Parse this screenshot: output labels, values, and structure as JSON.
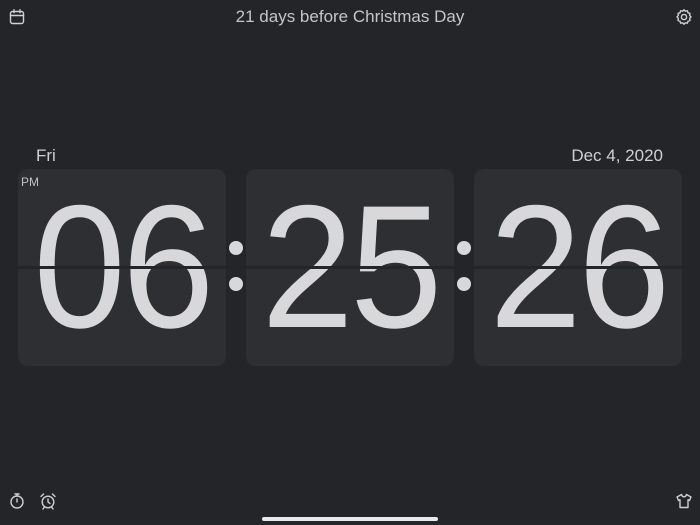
{
  "header": {
    "countdown_text": "21 days before Christmas Day"
  },
  "clock": {
    "weekday": "Fri",
    "date": "Dec 4, 2020",
    "period": "PM",
    "hours": "06",
    "minutes": "25",
    "seconds": "26"
  },
  "icons": {
    "top_left": "calendar-icon",
    "top_right": "gear-icon",
    "bottom_left_1": "stopwatch-icon",
    "bottom_left_2": "alarm-clock-icon",
    "bottom_right": "tshirt-icon"
  },
  "colors": {
    "background": "#232528",
    "card": "#2d2f33",
    "digits": "#d8d8da",
    "text": "#c9c9cc"
  }
}
